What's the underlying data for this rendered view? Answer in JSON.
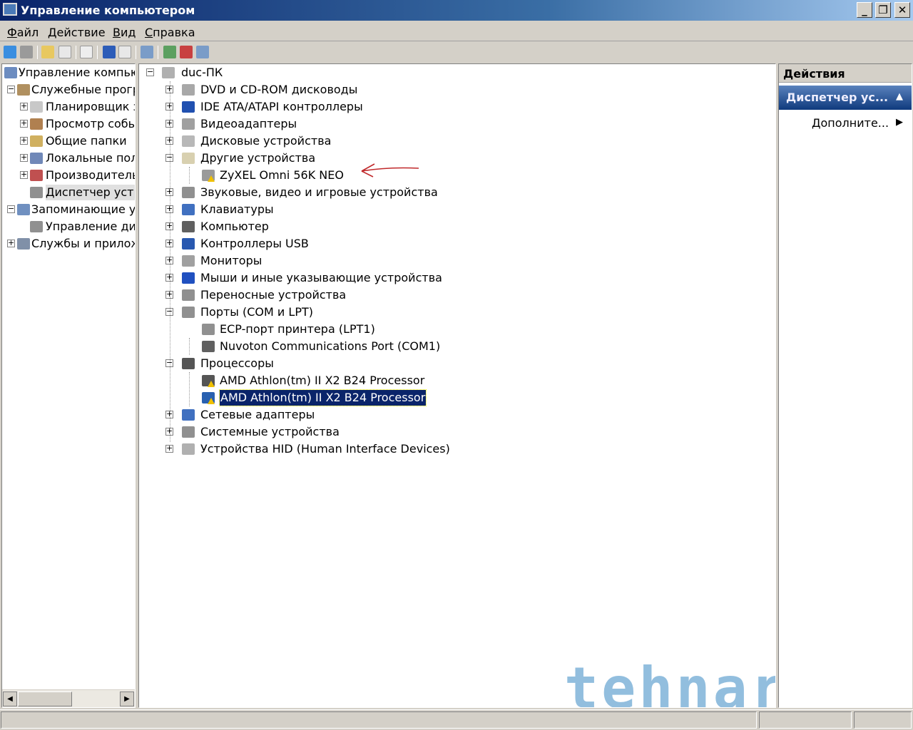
{
  "window": {
    "title": "Управление компьютером",
    "minimize": "_",
    "restore": "❐",
    "close": "✕"
  },
  "menu": [
    {
      "u": "Ф",
      "rest": "айл"
    },
    {
      "u": "Д",
      "rest": "ействие"
    },
    {
      "u": "В",
      "rest": "ид"
    },
    {
      "u": "С",
      "rest": "правка"
    }
  ],
  "left_tree": [
    {
      "label": "Управление компьют",
      "level": 0,
      "exp": ""
    },
    {
      "label": "Служебные програ",
      "level": 1,
      "exp": "−"
    },
    {
      "label": "Планировщик за",
      "level": 2,
      "exp": "+"
    },
    {
      "label": "Просмотр событ",
      "level": 2,
      "exp": "+"
    },
    {
      "label": "Общие папки",
      "level": 2,
      "exp": "+"
    },
    {
      "label": "Локальные поль",
      "level": 2,
      "exp": "+"
    },
    {
      "label": "Производительн",
      "level": 2,
      "exp": "+"
    },
    {
      "label": "Диспетчер устро",
      "level": 2,
      "exp": "",
      "selected": true
    },
    {
      "label": "Запоминающие ус",
      "level": 1,
      "exp": "−"
    },
    {
      "label": "Управление дис",
      "level": 2,
      "exp": ""
    },
    {
      "label": "Службы и приложе",
      "level": 1,
      "exp": "+"
    }
  ],
  "device_tree": [
    {
      "label": "duc-ПК",
      "level": 0,
      "exp": "−"
    },
    {
      "label": "DVD и CD-ROM дисководы",
      "level": 1,
      "exp": "+"
    },
    {
      "label": "IDE ATA/ATAPI контроллеры",
      "level": 1,
      "exp": "+"
    },
    {
      "label": "Видеоадаптеры",
      "level": 1,
      "exp": "+"
    },
    {
      "label": "Дисковые устройства",
      "level": 1,
      "exp": "+"
    },
    {
      "label": "Другие устройства",
      "level": 1,
      "exp": "−"
    },
    {
      "label": "ZyXEL Omni 56K NEO",
      "level": 2,
      "warn": true
    },
    {
      "label": "Звуковые, видео и игровые устройства",
      "level": 1,
      "exp": "+"
    },
    {
      "label": "Клавиатуры",
      "level": 1,
      "exp": "+"
    },
    {
      "label": "Компьютер",
      "level": 1,
      "exp": "+"
    },
    {
      "label": "Контроллеры USB",
      "level": 1,
      "exp": "+"
    },
    {
      "label": "Мониторы",
      "level": 1,
      "exp": "+"
    },
    {
      "label": "Мыши и иные указывающие устройства",
      "level": 1,
      "exp": "+"
    },
    {
      "label": "Переносные устройства",
      "level": 1,
      "exp": "+"
    },
    {
      "label": "Порты (COM и LPT)",
      "level": 1,
      "exp": "−"
    },
    {
      "label": "ECP-порт принтера (LPT1)",
      "level": 2
    },
    {
      "label": "Nuvoton Communications Port (COM1)",
      "level": 2
    },
    {
      "label": "Процессоры",
      "level": 1,
      "exp": "−"
    },
    {
      "label": "AMD Athlon(tm) II X2 B24 Processor",
      "level": 2,
      "warn": true
    },
    {
      "label": "AMD Athlon(tm) II X2 B24 Processor",
      "level": 2,
      "warn": true,
      "selected": true
    },
    {
      "label": "Сетевые адаптеры",
      "level": 1,
      "exp": "+"
    },
    {
      "label": "Системные устройства",
      "level": 1,
      "exp": "+"
    },
    {
      "label": "Устройства HID (Human Interface Devices)",
      "level": 1,
      "exp": "+"
    }
  ],
  "actions": {
    "header": "Действия",
    "group": "Диспетчер ус...",
    "item": "Дополните..."
  },
  "watermark": "tehnari.ru",
  "colors": {
    "selection": "#0a246a",
    "arrow": "#c0282a"
  }
}
